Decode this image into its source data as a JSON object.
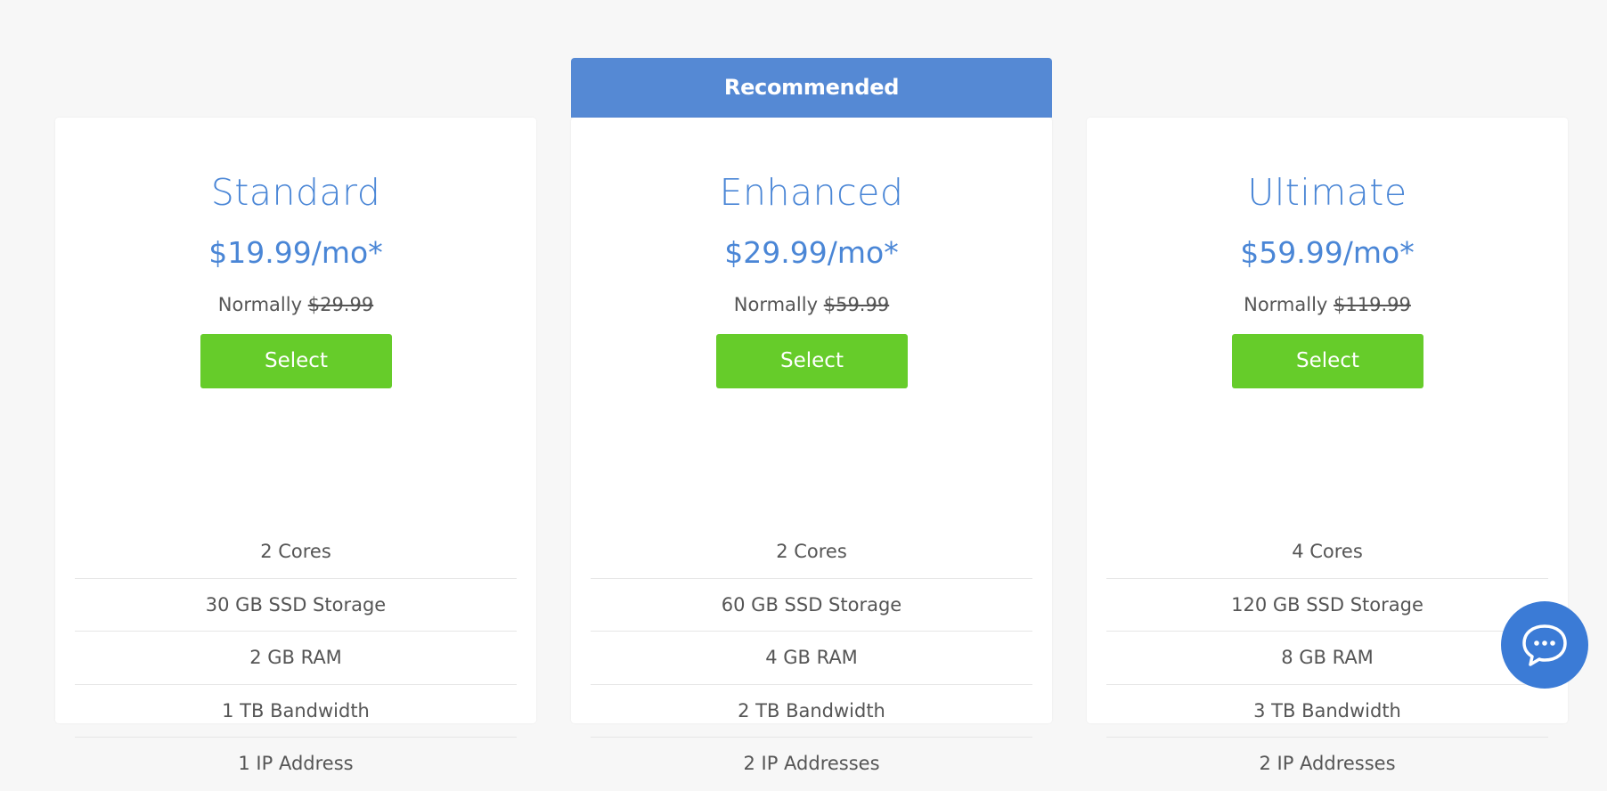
{
  "banner": {
    "label": "Recommended"
  },
  "plans": [
    {
      "name": "Standard",
      "price": "$19.99/mo*",
      "normally_label": "Normally",
      "normal_price": "$29.99",
      "select_label": "Select",
      "features": [
        "2 Cores",
        "30 GB SSD Storage",
        "2 GB RAM",
        "1 TB Bandwidth",
        "1 IP Address"
      ]
    },
    {
      "name": "Enhanced",
      "price": "$29.99/mo*",
      "normally_label": "Normally",
      "normal_price": "$59.99",
      "select_label": "Select",
      "features": [
        "2 Cores",
        "60 GB SSD Storage",
        "4 GB RAM",
        "2 TB Bandwidth",
        "2 IP Addresses"
      ]
    },
    {
      "name": "Ultimate",
      "price": "$59.99/mo*",
      "normally_label": "Normally",
      "normal_price": "$119.99",
      "select_label": "Select",
      "features": [
        "4 Cores",
        "120 GB SSD Storage",
        "8 GB RAM",
        "3 TB Bandwidth",
        "2 IP Addresses"
      ]
    }
  ],
  "chat": {
    "icon": "chat-bubble-icon"
  },
  "colors": {
    "accent_blue": "#4a86d6",
    "banner_blue": "#5589d4",
    "select_green": "#66cc2a",
    "chat_blue": "#3b7bd6"
  }
}
